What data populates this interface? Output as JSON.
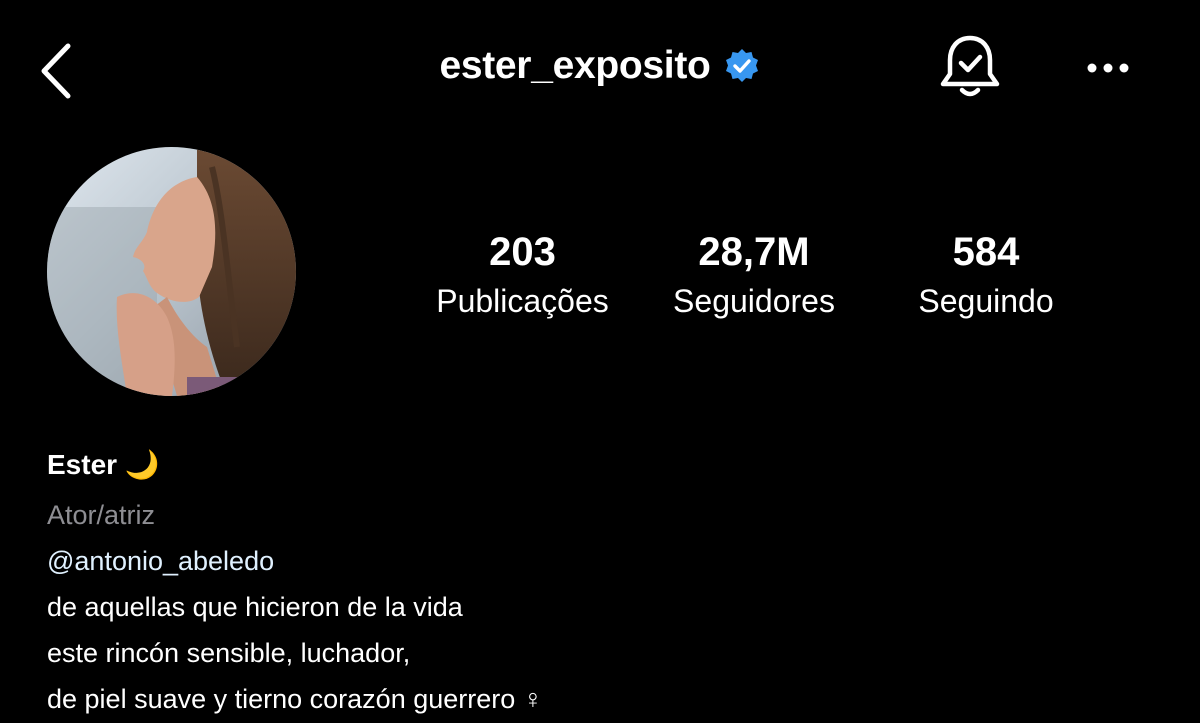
{
  "header": {
    "username": "ester_exposito",
    "verified": true,
    "icons": {
      "back": "chevron-left-icon",
      "verified": "verified-badge-icon",
      "notifications": "bell-check-icon",
      "more": "more-horizontal-icon"
    }
  },
  "profile": {
    "avatar": "profile-photo",
    "stats": {
      "posts": {
        "value": "203",
        "label": "Publicações"
      },
      "followers": {
        "value": "28,7M",
        "label": "Seguidores"
      },
      "following": {
        "value": "584",
        "label": "Seguindo"
      }
    }
  },
  "bio": {
    "name": "Ester 🌙",
    "category": "Ator/atriz",
    "mention": "@antonio_abeledo",
    "lines": [
      "de aquellas que hicieron de la vida",
      "este rincón sensible, luchador,",
      "de piel suave y tierno corazón guerrero ♀"
    ]
  },
  "colors": {
    "background": "#000000",
    "text": "#ffffff",
    "muted": "#8e8e93",
    "verified": "#3897f0",
    "mention": "#e0f1ff"
  }
}
